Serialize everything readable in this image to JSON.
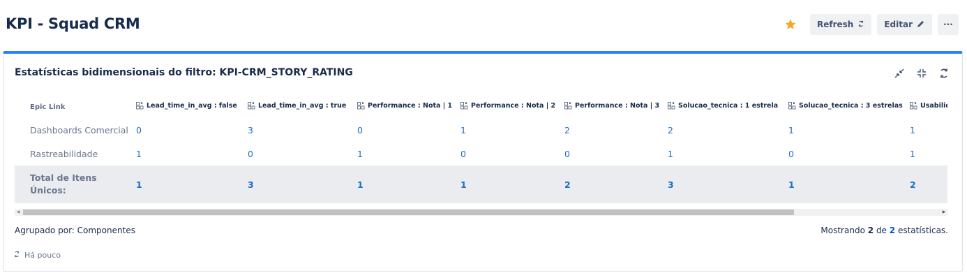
{
  "page": {
    "title": "KPI - Squad CRM",
    "actions": {
      "refresh_label": "Refresh",
      "edit_label": "Editar",
      "more_label": "···"
    },
    "star_color": "#f6a623",
    "refresh_icon": "refresh-icon",
    "edit_icon": "pencil-icon"
  },
  "gadget": {
    "title": "Estatísticas bidimensionais do filtro: KPI-CRM_STORY_RATING",
    "accent_color": "#2684ff",
    "tools": [
      "minimize-icon",
      "collapse-icon",
      "refresh-icon"
    ],
    "table": {
      "first_header": "Epic Link",
      "columns": [
        "Lead_time_in_avg : false",
        "Lead_time_in_avg : true",
        "Performance : Nota | 1",
        "Performance : Nota | 2",
        "Performance : Nota | 3",
        "Solucao_tecnica : 1 estrela",
        "Solucao_tecnica : 3 estrelas",
        "Usabilid"
      ],
      "rows": [
        {
          "label": "Dashboards Comercial",
          "values": [
            "0",
            "3",
            "0",
            "1",
            "2",
            "2",
            "1",
            "1"
          ]
        },
        {
          "label": "Rastreabilidade",
          "values": [
            "1",
            "0",
            "1",
            "0",
            "0",
            "1",
            "0",
            "1"
          ]
        }
      ],
      "total": {
        "label": "Total de Itens Únicos:",
        "values": [
          "1",
          "3",
          "1",
          "1",
          "2",
          "3",
          "1",
          "2"
        ]
      }
    },
    "footer": {
      "grouped_by": "Agrupado por: Componentes",
      "showing_prefix": "Mostrando",
      "showing_count": "2",
      "showing_of": "de",
      "showing_total": "2",
      "showing_suffix": "estatísticas.",
      "updated": "Há pouco"
    }
  }
}
